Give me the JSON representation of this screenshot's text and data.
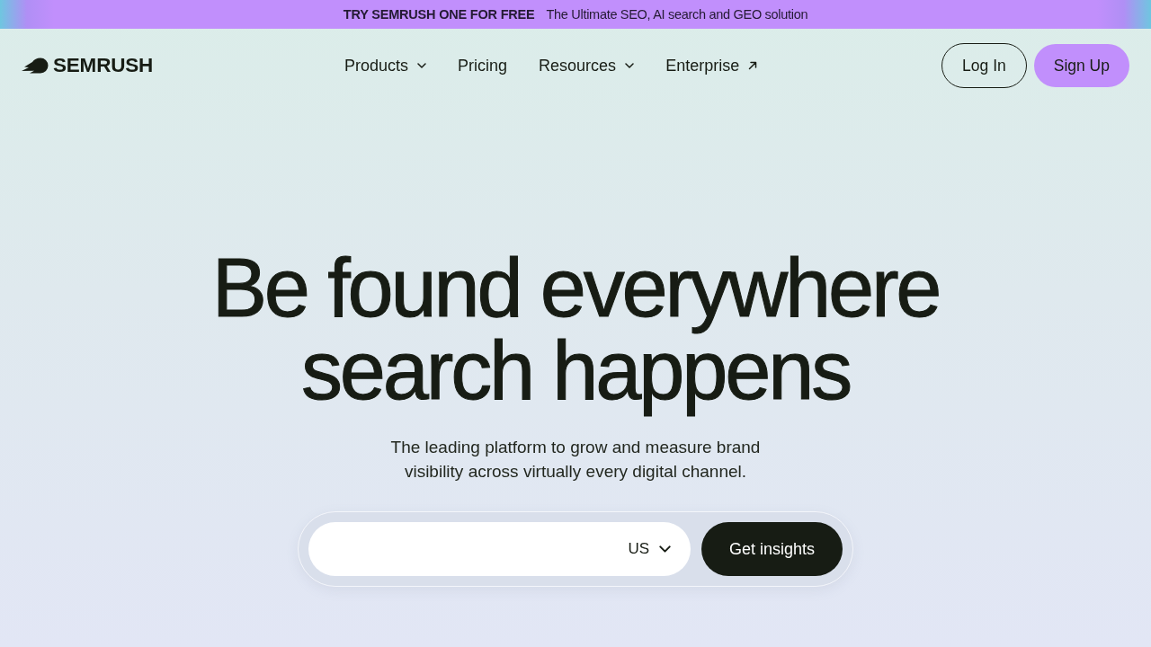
{
  "banner": {
    "headline": "TRY SEMRUSH ONE FOR FREE",
    "text": "The Ultimate SEO, AI search and GEO solution"
  },
  "nav": {
    "logo": "SEMRUSH",
    "items": [
      {
        "label": "Products",
        "kind": "dropdown"
      },
      {
        "label": "Pricing",
        "kind": "link"
      },
      {
        "label": "Resources",
        "kind": "dropdown"
      },
      {
        "label": "Enterprise",
        "kind": "external"
      }
    ],
    "buttons": [
      {
        "label": "Log In",
        "kind": "outline"
      },
      {
        "label": "Sign Up",
        "kind": "primary"
      }
    ]
  },
  "hero": {
    "title": "Be found everywhere search happens",
    "subtitle": "The leading platform to grow and measure brand visibility across virtually every digital channel.",
    "search": {
      "country": "US",
      "button": "Get insights"
    }
  }
}
